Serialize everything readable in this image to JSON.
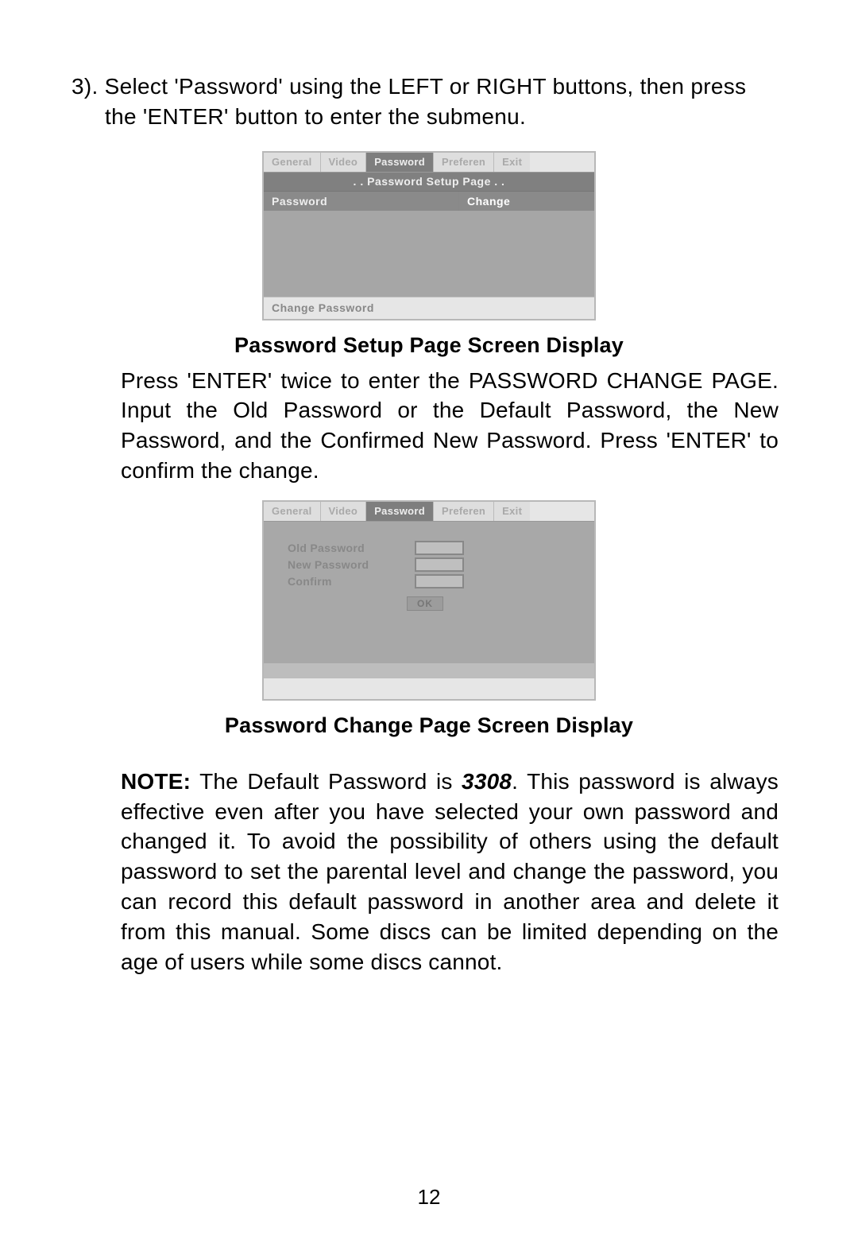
{
  "step3": {
    "line1": "3). Select 'Password' using the  LEFT or RIGHT buttons, then press",
    "line2": "the 'ENTER' button to enter the submenu."
  },
  "device1": {
    "tabs": [
      "General",
      "Video",
      "Password",
      "Preferen",
      "Exit"
    ],
    "active_tab_index": 2,
    "subtitle": ". . Password Setup Page . .",
    "row_left": "Password",
    "row_right": "Change",
    "status": "Change Password"
  },
  "caption1": "Password Setup Page Screen Display",
  "para1": "Press 'ENTER' twice to enter the PASSWORD CHANGE PAGE. Input the Old  Password or the Default Password, the New Password, and the Confirmed New Password. Press 'ENTER' to confirm the change.",
  "device2": {
    "tabs": [
      "General",
      "Video",
      "Password",
      "Preferen",
      "Exit"
    ],
    "active_tab_index": 2,
    "labels": {
      "old": "Old Password",
      "new": "New Password",
      "confirm": "Confirm"
    },
    "ok": "OK"
  },
  "caption2": "Password Change Page Screen Display",
  "note": {
    "label": "NOTE:",
    "pre": " The Default Password is ",
    "code": "3308",
    "post": ".  This password  is always effective even after you have selected your own password  and changed it. To avoid  the possibility of others using the default password to set the parental level and change the password, you can  record  this default password in another area  and delete it from this  manual. Some discs can be limited depending on the age of users while some discs cannot."
  },
  "page_number": "12"
}
